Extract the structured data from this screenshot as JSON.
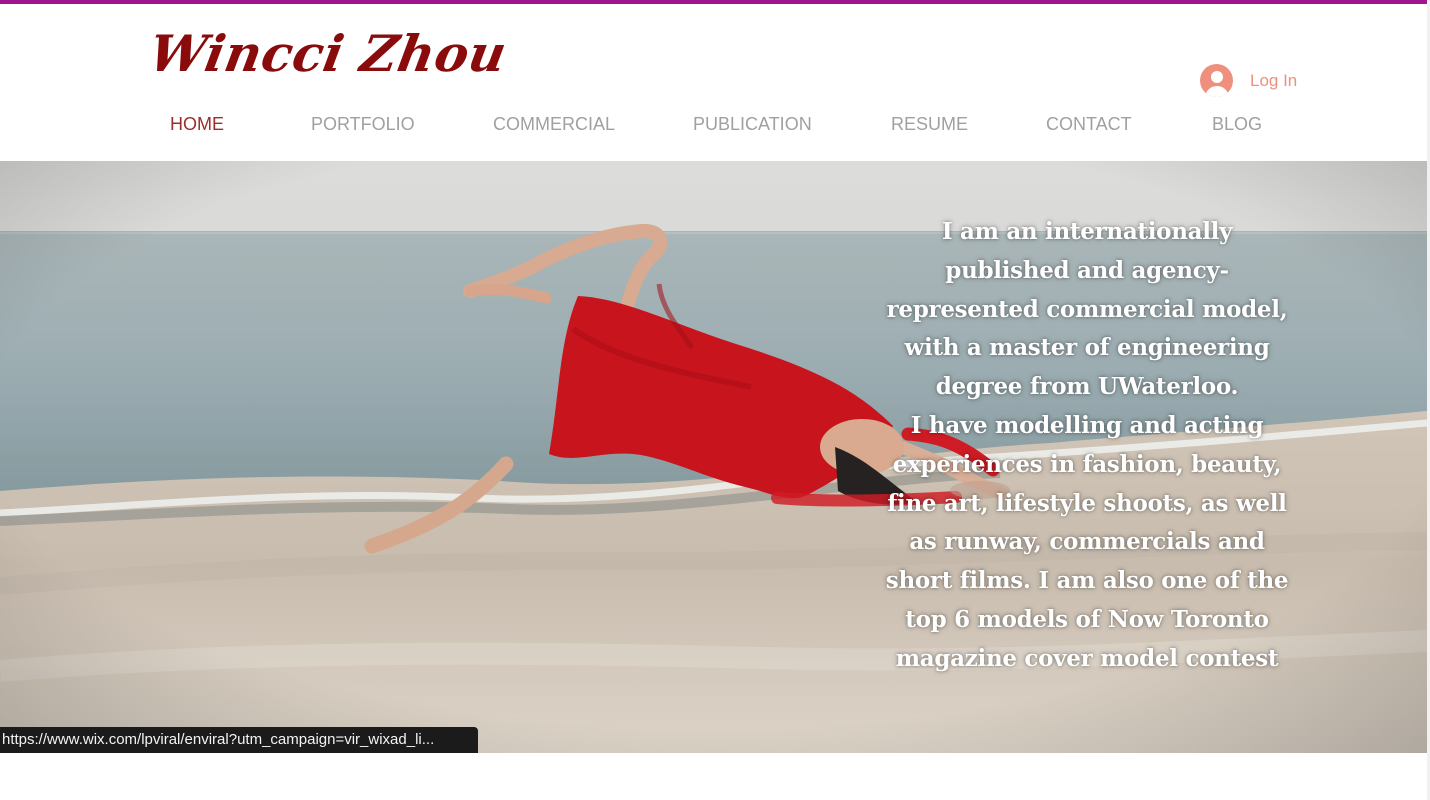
{
  "site": {
    "logo": "Wincci Zhou",
    "login_label": "Log In",
    "nav": [
      {
        "label": "HOME",
        "active": true
      },
      {
        "label": "PORTFOLIO",
        "active": false
      },
      {
        "label": "COMMERCIAL",
        "active": false
      },
      {
        "label": "PUBLICATION",
        "active": false
      },
      {
        "label": "RESUME",
        "active": false
      },
      {
        "label": "CONTACT",
        "active": false
      },
      {
        "label": "BLOG",
        "active": false
      }
    ]
  },
  "hero": {
    "intro_lines": [
      "I am an internationally",
      "published and agency-",
      "represented commercial model,",
      "with a master of engineering",
      "degree from UWaterloo.",
      "I have modelling and acting",
      "experiences in fashion, beauty,",
      "fine art, lifestyle shoots, as well",
      "as runway, commercials and",
      "short films. I am also one of the",
      "top 6 models of Now Toronto",
      "magazine cover model contest"
    ],
    "image_name": "beach-dancer-photo"
  },
  "browser_status": {
    "url": "https://www.wix.com/lpviral/enviral?utm_campaign=vir_wixad_li..."
  },
  "colors": {
    "top_accent": "#a0168f",
    "logo": "#8a0b0b",
    "nav_active": "#9b2d2d",
    "nav_inactive": "#a0a0a0",
    "login": "#ef8f7e",
    "hero_text": "#ffffff"
  },
  "icons": {
    "login": "user-avatar-icon"
  }
}
